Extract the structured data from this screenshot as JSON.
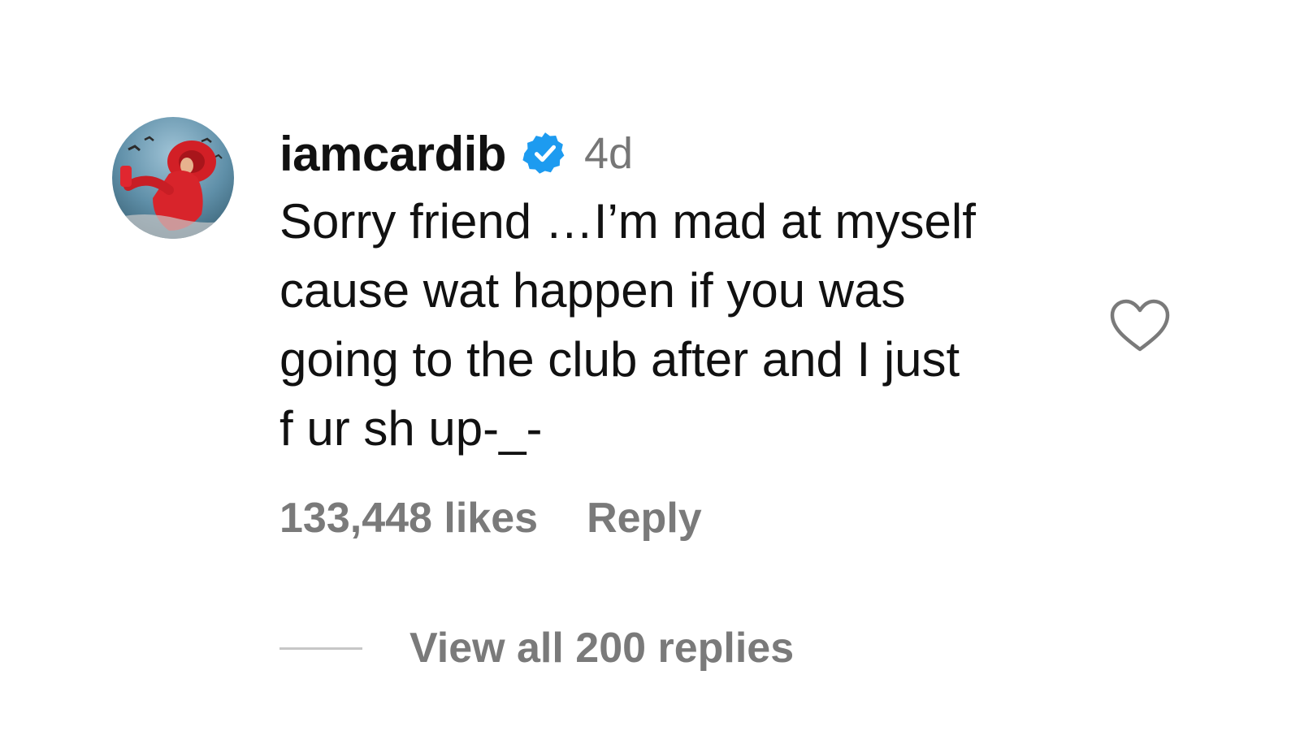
{
  "comment": {
    "username": "iamcardib",
    "verified_icon": "verified-badge-icon",
    "timestamp": "4d",
    "text": "Sorry friend …I’m mad at myself\ncause wat happen if you was\ngoing to the club after and I just\nf ur sh up-_-",
    "likes": "133,448 likes",
    "reply_label": "Reply",
    "view_replies_label": "View all 200 replies",
    "like_icon": "heart-outline-icon",
    "colors": {
      "verified": "#1D9BF0",
      "meta": "#7A7A7A",
      "text": "#111111"
    }
  }
}
